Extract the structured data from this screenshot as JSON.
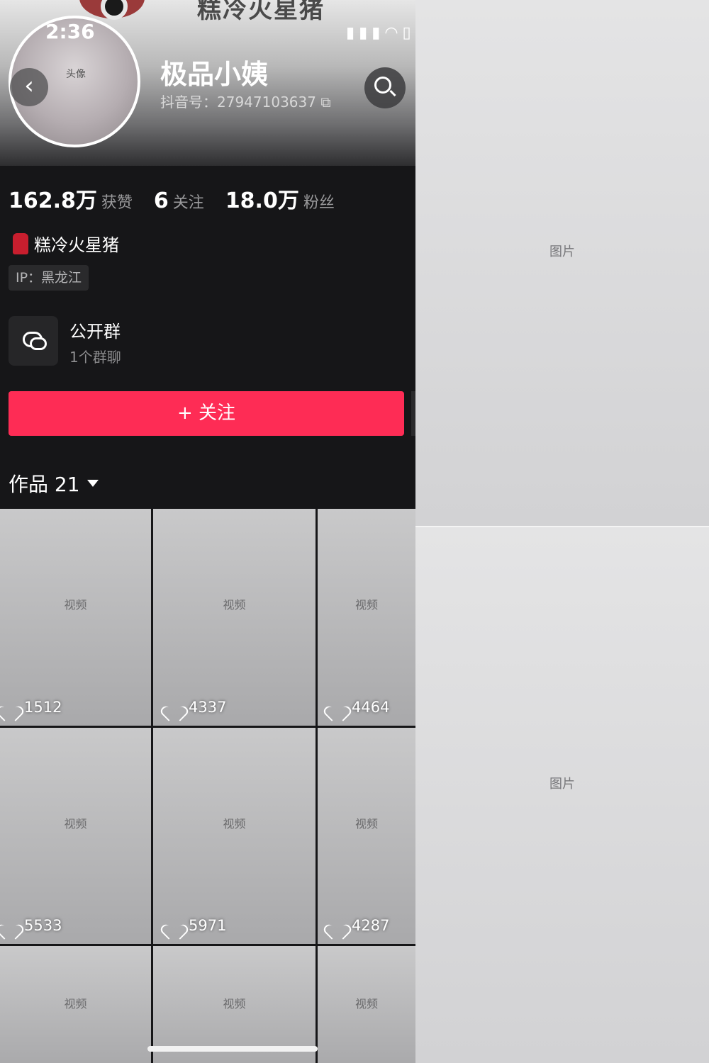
{
  "header": {
    "brand_text": "糕冷火星猪",
    "status_time": "2:36",
    "back_icon": "chevron-left-icon",
    "status_icons": [
      "signal-icon",
      "wifi-icon",
      "battery-icon"
    ],
    "search_icon": "search-icon"
  },
  "profile": {
    "nickname": "极品小姨",
    "douyin_id": "抖音号：27947103637",
    "copy_icon": "copy-icon",
    "bio": "糕冷火星猪",
    "ip": "IP：黑龙江"
  },
  "stats": [
    {
      "value": "162.8万",
      "label": "获赞"
    },
    {
      "value": "6",
      "label": "关注"
    },
    {
      "value": "18.0万",
      "label": "粉丝"
    }
  ],
  "group": {
    "title": "公开群",
    "subtitle": "1个群聊",
    "icon": "chat-bubbles-icon"
  },
  "follow_button": "+ 关注",
  "works": {
    "label": "作品 21",
    "items": [
      {
        "likes": "1512"
      },
      {
        "likes": "4337"
      },
      {
        "likes": "4464"
      },
      {
        "likes": "5533"
      },
      {
        "likes": "5971"
      },
      {
        "likes": "4287"
      },
      {
        "likes": ""
      },
      {
        "likes": ""
      },
      {
        "likes": ""
      }
    ]
  },
  "colors": {
    "accent": "#fe2c55",
    "background": "#161618"
  }
}
